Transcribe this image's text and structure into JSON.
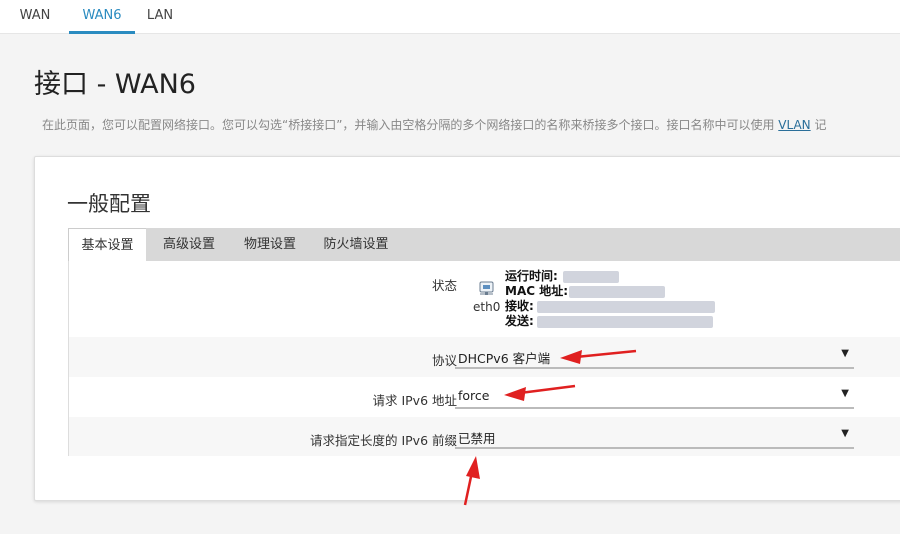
{
  "top_tabs": [
    {
      "label": "WAN",
      "active": false
    },
    {
      "label": "WAN6",
      "active": true
    },
    {
      "label": "LAN",
      "active": false
    }
  ],
  "page": {
    "title": "接口 - WAN6",
    "description": "在此页面，您可以配置网络接口。您可以勾选“桥接接口”，并输入由空格分隔的多个网络接口的名称来桥接多个接口。接口名称中可以使用",
    "description_link": "VLAN",
    "description_tail": "记"
  },
  "section": {
    "title": "一般配置",
    "tabs": [
      {
        "label": "基本设置",
        "active": true
      },
      {
        "label": "高级设置",
        "active": false
      },
      {
        "label": "物理设置",
        "active": false
      },
      {
        "label": "防火墙设置",
        "active": false
      }
    ]
  },
  "status": {
    "label": "状态",
    "ifname": "eth0",
    "icon": "network-port-icon",
    "fields": [
      "运行时间:",
      "MAC 地址:",
      "接收:",
      "发送:"
    ]
  },
  "fields": {
    "protocol": {
      "label": "协议",
      "value": "DHCPv6 客户端"
    },
    "request_ipv6": {
      "label": "请求 IPv6 地址",
      "value": "force"
    },
    "prefix_length": {
      "label": "请求指定长度的 IPv6 前缀",
      "value": "已禁用"
    }
  },
  "colors": {
    "accent": "#2a8bc0",
    "annotation_arrow": "#e02020"
  }
}
